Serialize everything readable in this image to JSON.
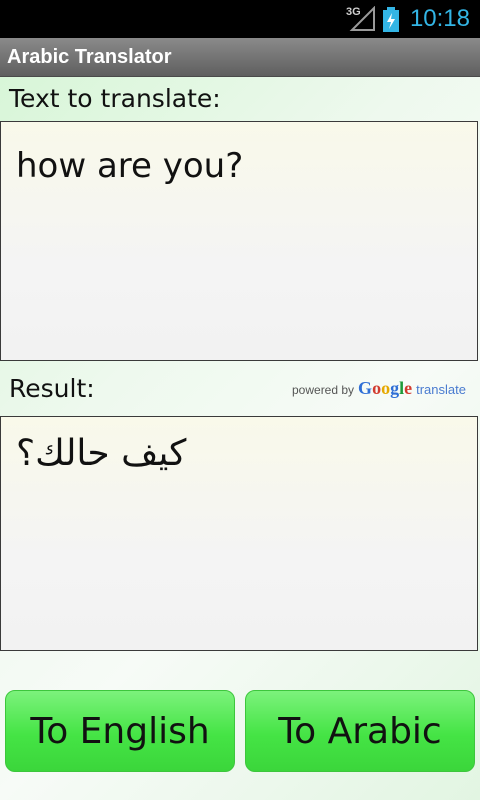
{
  "status_bar": {
    "network": "3G",
    "time": "10:18",
    "accent_color": "#33b5e5",
    "icons": [
      "signal-icon",
      "battery-charging-icon"
    ]
  },
  "app": {
    "title": "Arabic Translator"
  },
  "source": {
    "label": "Text to translate:",
    "value": "how are you?"
  },
  "result": {
    "label": "Result:",
    "value": "كيف حالك؟"
  },
  "attribution": {
    "powered_by": "powered by",
    "brand_letters": [
      "G",
      "o",
      "o",
      "g",
      "l",
      "e"
    ],
    "service": "translate"
  },
  "buttons": {
    "to_english": "To English",
    "to_arabic": "To Arabic",
    "color": "#45e445"
  }
}
